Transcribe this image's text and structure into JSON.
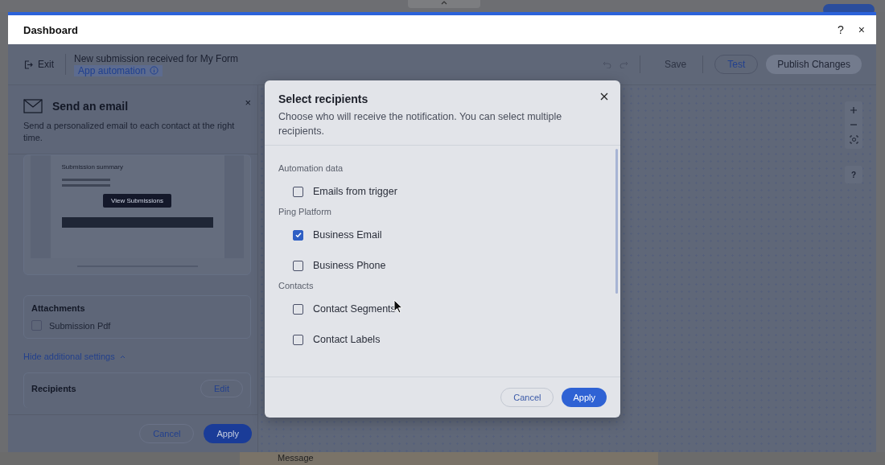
{
  "window": {
    "title": "Dashboard",
    "help": "?",
    "close": "×"
  },
  "toolbar": {
    "exit": "Exit",
    "title": "New submission received for My Form",
    "badge": "App automation",
    "save": "Save",
    "test": "Test",
    "publish": "Publish Changes"
  },
  "panel": {
    "title": "Send an email",
    "description": "Send a personalized email to each contact at the right time.",
    "close": "×",
    "preview": {
      "summary": "Submission summary",
      "button": "View Submissions"
    },
    "attachments": {
      "title": "Attachments",
      "items": [
        {
          "label": "Submission Pdf",
          "checked": false
        }
      ]
    },
    "toggle": "Hide additional settings",
    "recipients": {
      "title": "Recipients",
      "edit": "Edit"
    },
    "cancel": "Cancel",
    "apply": "Apply"
  },
  "canvas": {
    "help": "?"
  },
  "modal": {
    "title": "Select recipients",
    "description": "Choose who will receive the notification. You can select multiple recipients.",
    "groups": [
      {
        "title": "Automation data",
        "options": [
          {
            "label": "Emails from trigger",
            "checked": false
          }
        ]
      },
      {
        "title": "Ping Platform",
        "options": [
          {
            "label": "Business Email",
            "checked": true
          },
          {
            "label": "Business Phone",
            "checked": false
          }
        ]
      },
      {
        "title": "Contacts",
        "options": [
          {
            "label": "Contact Segments",
            "checked": false
          },
          {
            "label": "Contact Labels",
            "checked": false
          }
        ]
      }
    ],
    "cancel": "Cancel",
    "apply": "Apply"
  },
  "background": {
    "label": "Message"
  }
}
